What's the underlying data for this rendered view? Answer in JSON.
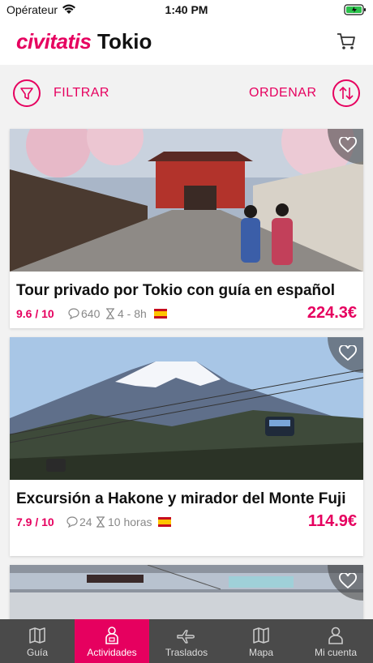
{
  "status": {
    "carrier": "Opérateur",
    "time": "1:40 PM"
  },
  "header": {
    "brand": "civitatis",
    "city": "Tokio"
  },
  "toolbar": {
    "filter_label": "FILTRAR",
    "sort_label": "ORDENAR"
  },
  "cards": [
    {
      "title": "Tour privado por Tokio con guía en español",
      "rating": "9.6 / 10",
      "reviews": "640",
      "duration": "4 - 8h",
      "price": "224.3€"
    },
    {
      "title": "Excursión a Hakone y mirador del Monte Fuji",
      "rating": "7.9 / 10",
      "reviews": "24",
      "duration": "10 horas",
      "price": "114.9€"
    }
  ],
  "tabs": [
    {
      "label": "Guía",
      "icon": "map-book-icon"
    },
    {
      "label": "Actividades",
      "icon": "person-icon"
    },
    {
      "label": "Traslados",
      "icon": "plane-icon"
    },
    {
      "label": "Mapa",
      "icon": "map-icon"
    },
    {
      "label": "Mi cuenta",
      "icon": "account-icon"
    }
  ],
  "colors": {
    "accent": "#e6005f",
    "tabbar": "#4a4a4a"
  }
}
